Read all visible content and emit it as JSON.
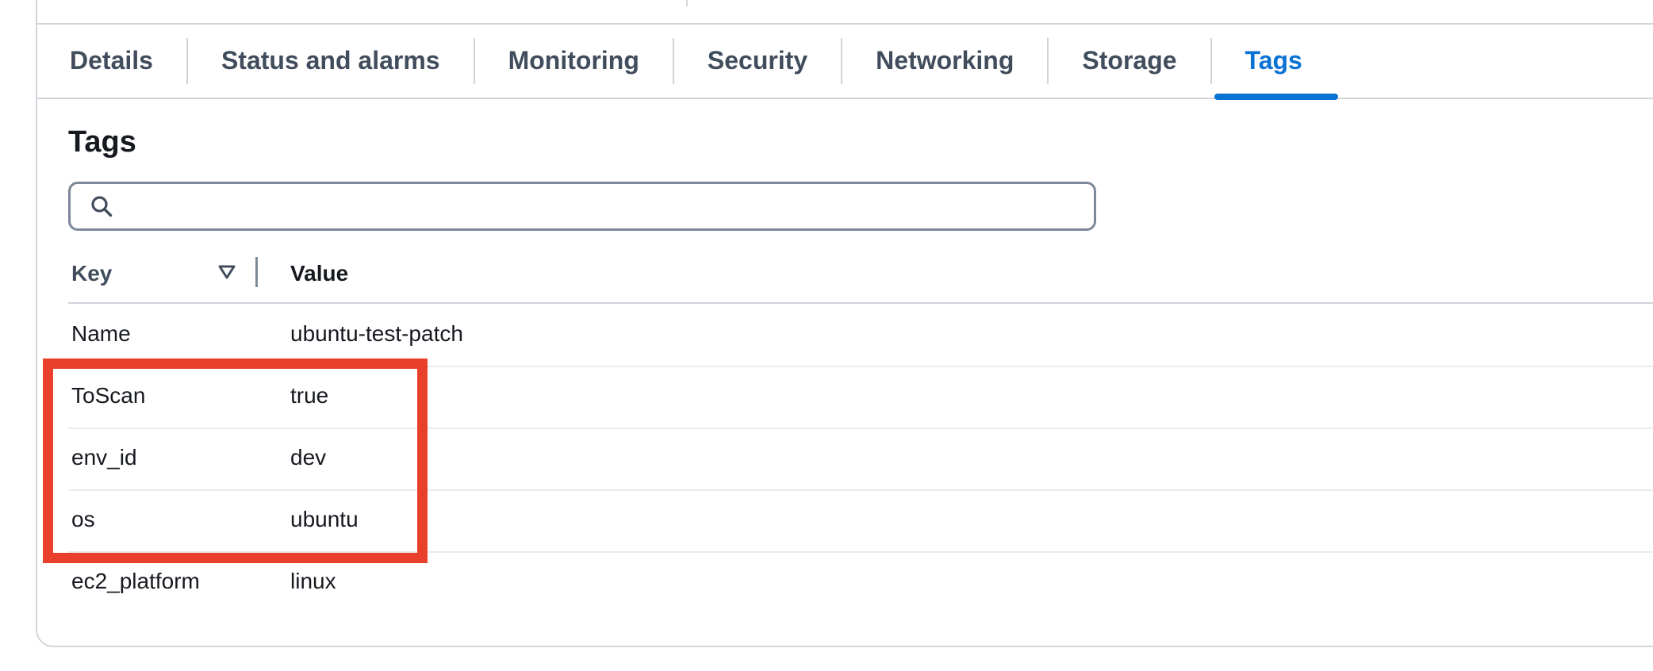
{
  "tabs": [
    {
      "label": "Details",
      "active": false
    },
    {
      "label": "Status and alarms",
      "active": false
    },
    {
      "label": "Monitoring",
      "active": false
    },
    {
      "label": "Security",
      "active": false
    },
    {
      "label": "Networking",
      "active": false
    },
    {
      "label": "Storage",
      "active": false
    },
    {
      "label": "Tags",
      "active": true
    }
  ],
  "tags_section": {
    "title": "Tags",
    "search": {
      "value": "",
      "placeholder": ""
    },
    "columns": {
      "key": "Key",
      "value": "Value"
    },
    "rows": [
      {
        "key": "Name",
        "value": "ubuntu-test-patch"
      },
      {
        "key": "ToScan",
        "value": "true"
      },
      {
        "key": "env_id",
        "value": "dev"
      },
      {
        "key": "os",
        "value": "ubuntu"
      },
      {
        "key": "ec2_platform",
        "value": "linux"
      }
    ]
  },
  "annotation": {
    "highlight_color": "#e8402a",
    "highlighted_keys": [
      "ToScan",
      "env_id",
      "os"
    ]
  },
  "icons": {
    "search": "search-icon",
    "sort": "sort-descending-icon"
  },
  "colors": {
    "accent": "#0972d3",
    "tab_text": "#414d5c",
    "border": "#d1d5db"
  }
}
